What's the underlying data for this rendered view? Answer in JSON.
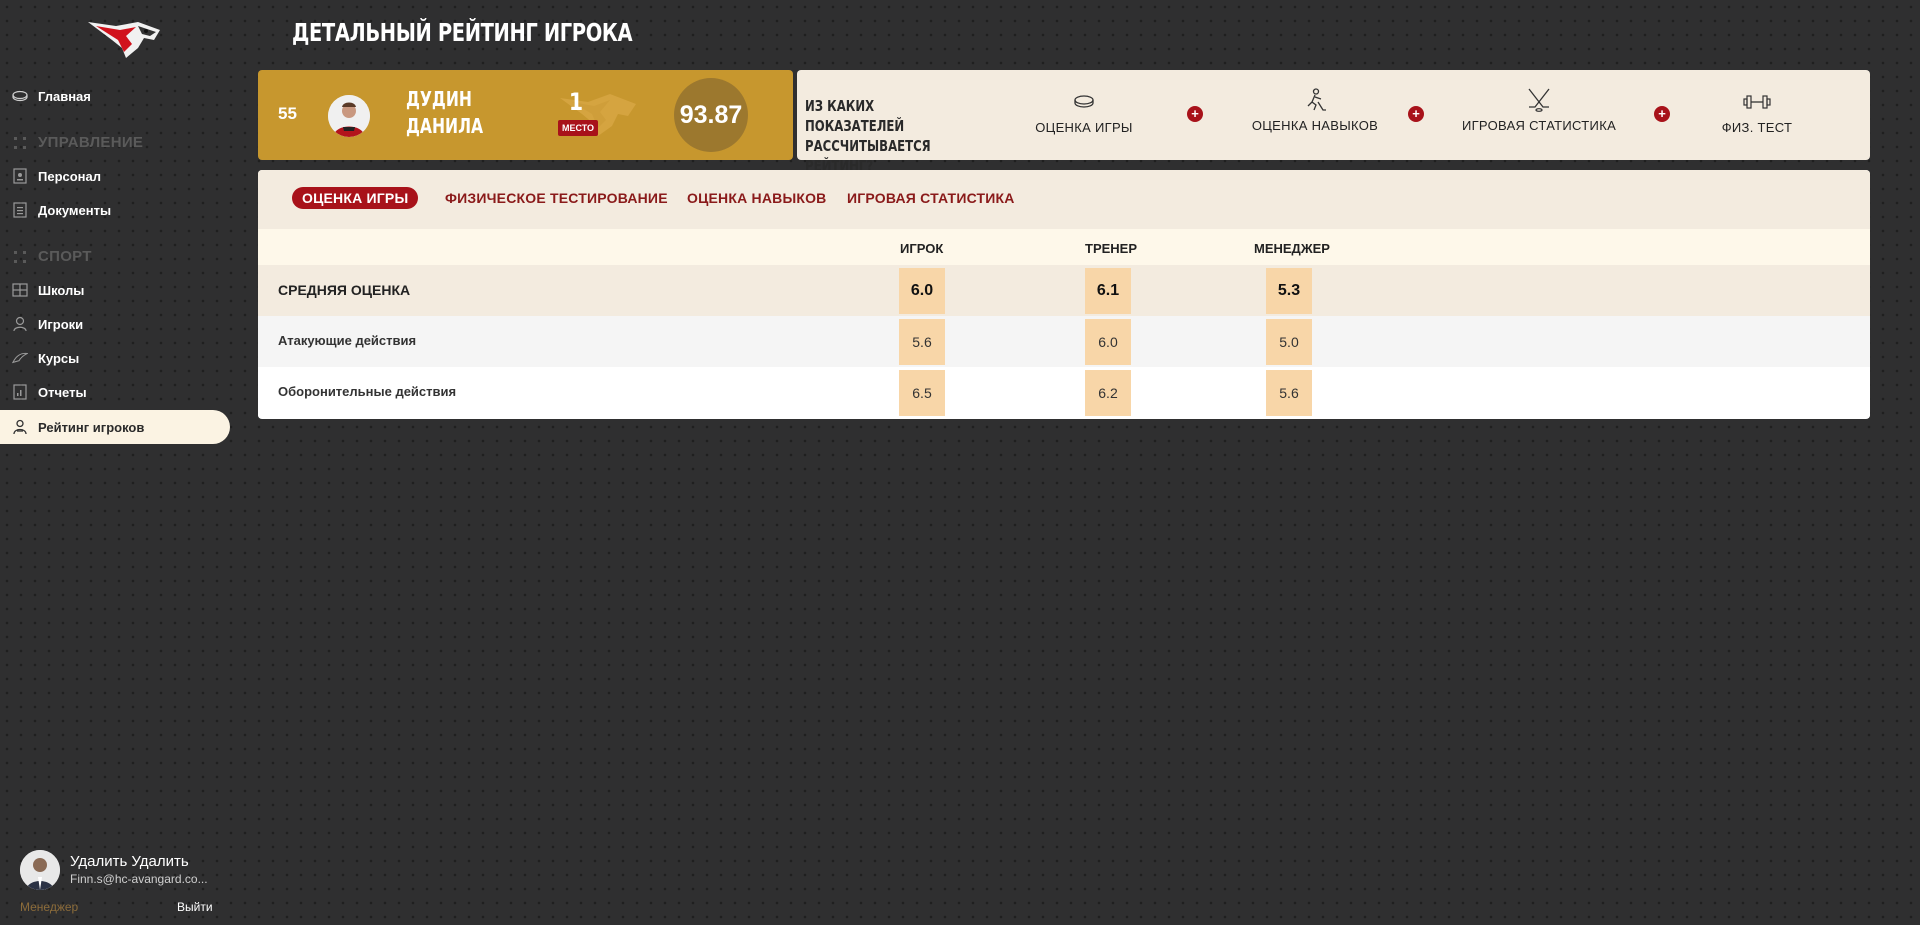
{
  "colors": {
    "background": "#2f2f30",
    "accent_red": "#a8121a",
    "gold": "#c7972e",
    "cream": "#f3ebdf",
    "cell": "#f8d6a8"
  },
  "sidebar": {
    "logo_icon": "hawk-logo-icon",
    "items": [
      {
        "label": "Главная",
        "icon": "puck-icon"
      },
      {
        "label": "Персонал",
        "icon": "badge-icon"
      },
      {
        "label": "Документы",
        "icon": "document-icon"
      },
      {
        "label": "Школы",
        "icon": "building-icon"
      },
      {
        "label": "Игроки",
        "icon": "player-icon"
      },
      {
        "label": "Курсы",
        "icon": "feather-icon"
      },
      {
        "label": "Отчеты",
        "icon": "report-icon"
      },
      {
        "label": "Рейтинг игроков",
        "icon": "rating-icon",
        "active": true
      }
    ],
    "sections": [
      "УПРАВЛЕНИЕ",
      "СПОРТ"
    ],
    "user": {
      "name": "Удалить Удалить",
      "email": "Finn.s@hc-avangard.co...",
      "role": "Менеджер",
      "logout": "Выйти"
    }
  },
  "page": {
    "title": "ДЕТАЛЬНЫЙ РЕЙТИНГ ИГРОКА"
  },
  "player": {
    "number": "55",
    "name_line1": "ДУДИН",
    "name_line2": "ДАНИЛА",
    "place": "1",
    "place_label": "МЕСТО",
    "score": "93.87"
  },
  "info": {
    "question": "ИЗ КАКИХ ПОКАЗАТЕЛЕЙ РАССЧИТЫВАЕТСЯ РЕЙТИНГ?",
    "items": [
      {
        "label": "ОЦЕНКА ИГРЫ",
        "icon": "puck-icon"
      },
      {
        "label": "ОЦЕНКА НАВЫКОВ",
        "icon": "skater-icon"
      },
      {
        "label": "ИГРОВАЯ СТАТИСТИКА",
        "icon": "crossed-sticks-icon"
      },
      {
        "label": "ФИЗ. ТЕСТ",
        "icon": "dumbbell-icon"
      }
    ],
    "plus": "+"
  },
  "tabs": [
    {
      "label": "ОЦЕНКА ИГРЫ",
      "active": true
    },
    {
      "label": "ФИЗИЧЕСКОЕ ТЕСТИРОВАНИЕ"
    },
    {
      "label": "ОЦЕНКА НАВЫКОВ"
    },
    {
      "label": "ИГРОВАЯ СТАТИСТИКА"
    }
  ],
  "table": {
    "columns": [
      "ИГРОК",
      "ТРЕНЕР",
      "МЕНЕДЖЕР"
    ],
    "rows": [
      {
        "label": "СРЕДНЯЯ ОЦЕНКА",
        "values": [
          "6.0",
          "6.1",
          "5.3"
        ]
      },
      {
        "label": "Атакующие действия",
        "values": [
          "5.6",
          "6.0",
          "5.0"
        ]
      },
      {
        "label": "Оборонительные действия",
        "values": [
          "6.5",
          "6.2",
          "5.6"
        ]
      }
    ]
  }
}
